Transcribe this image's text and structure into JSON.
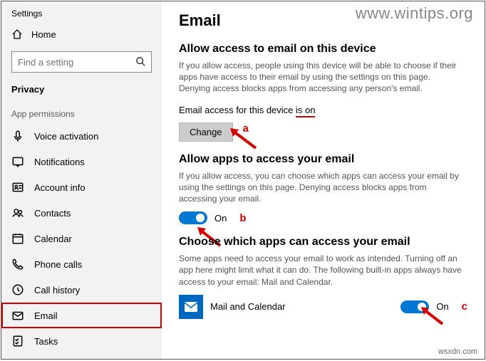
{
  "window": {
    "title": "Settings"
  },
  "sidebar": {
    "home": "Home",
    "search_placeholder": "Find a setting",
    "section": "Privacy",
    "group": "App permissions",
    "items": [
      {
        "label": "Voice activation"
      },
      {
        "label": "Notifications"
      },
      {
        "label": "Account info"
      },
      {
        "label": "Contacts"
      },
      {
        "label": "Calendar"
      },
      {
        "label": "Phone calls"
      },
      {
        "label": "Call history"
      },
      {
        "label": "Email"
      },
      {
        "label": "Tasks"
      }
    ]
  },
  "page": {
    "title": "Email",
    "section1": {
      "heading": "Allow access to email on this device",
      "desc": "If you allow access, people using this device will be able to choose if their apps have access to their email by using the settings on this page. Denying access blocks apps from accessing any person's email.",
      "status_prefix": "Email access for this device ",
      "status_value": "is on",
      "button": "Change",
      "annot": "a"
    },
    "section2": {
      "heading": "Allow apps to access your email",
      "desc": "If you allow access, you can choose which apps can access your email by using the settings on this page. Denying access blocks apps from accessing your email.",
      "toggle_label": "On",
      "annot": "b"
    },
    "section3": {
      "heading": "Choose which apps can access your email",
      "desc": "Some apps need to access your email to work as intended. Turning off an app here might limit what it can do. The following built-in apps always have access to your email: Mail and Calendar.",
      "app_name": "Mail and Calendar",
      "toggle_label": "On",
      "annot": "c"
    }
  },
  "watermark": "www.wintips.org",
  "watermark2": "wsxdn.com"
}
